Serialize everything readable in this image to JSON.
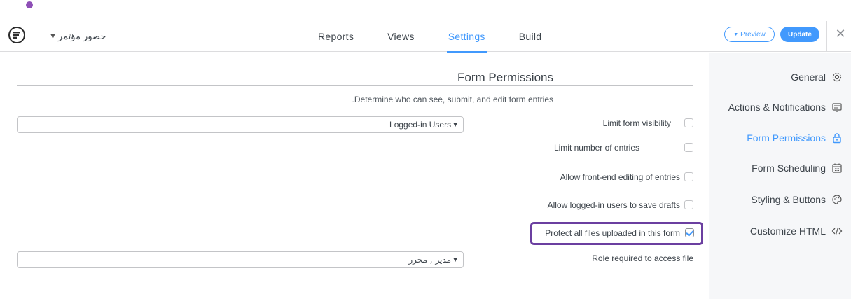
{
  "header": {
    "form_name": "حضور مؤتمر",
    "tabs": [
      {
        "label": "Reports"
      },
      {
        "label": "Views"
      },
      {
        "label": "Settings"
      },
      {
        "label": "Build"
      }
    ],
    "active_tab": "Settings",
    "preview_label": "Preview",
    "update_label": "Update"
  },
  "sidebar": {
    "items": [
      {
        "label": "General",
        "icon": "gear-icon"
      },
      {
        "label": "Actions & Notifications",
        "icon": "notification-icon"
      },
      {
        "label": "Form Permissions",
        "icon": "lock-icon",
        "active": true
      },
      {
        "label": "Form Scheduling",
        "icon": "calendar-icon"
      },
      {
        "label": "Styling & Buttons",
        "icon": "palette-icon"
      },
      {
        "label": "Customize HTML",
        "icon": "code-icon"
      }
    ]
  },
  "main": {
    "title": "Form Permissions",
    "description": ".Determine who can see, submit, and edit form entries",
    "options": [
      {
        "label": "Limit form visibility",
        "checked": false,
        "select_value": "Logged-in Users"
      },
      {
        "label": "Limit number of entries",
        "checked": false
      },
      {
        "label": "Allow front-end editing of entries",
        "checked": false
      },
      {
        "label": "Allow logged-in users to save drafts",
        "checked": false
      },
      {
        "label": "Protect all files uploaded in this form",
        "checked": true
      }
    ],
    "role_label": "Role required to access file",
    "role_value": "مدير , محرر"
  },
  "colors": {
    "accent": "#4199fd",
    "highlight": "#6b3fa0",
    "dot": "#8e4fb6"
  }
}
